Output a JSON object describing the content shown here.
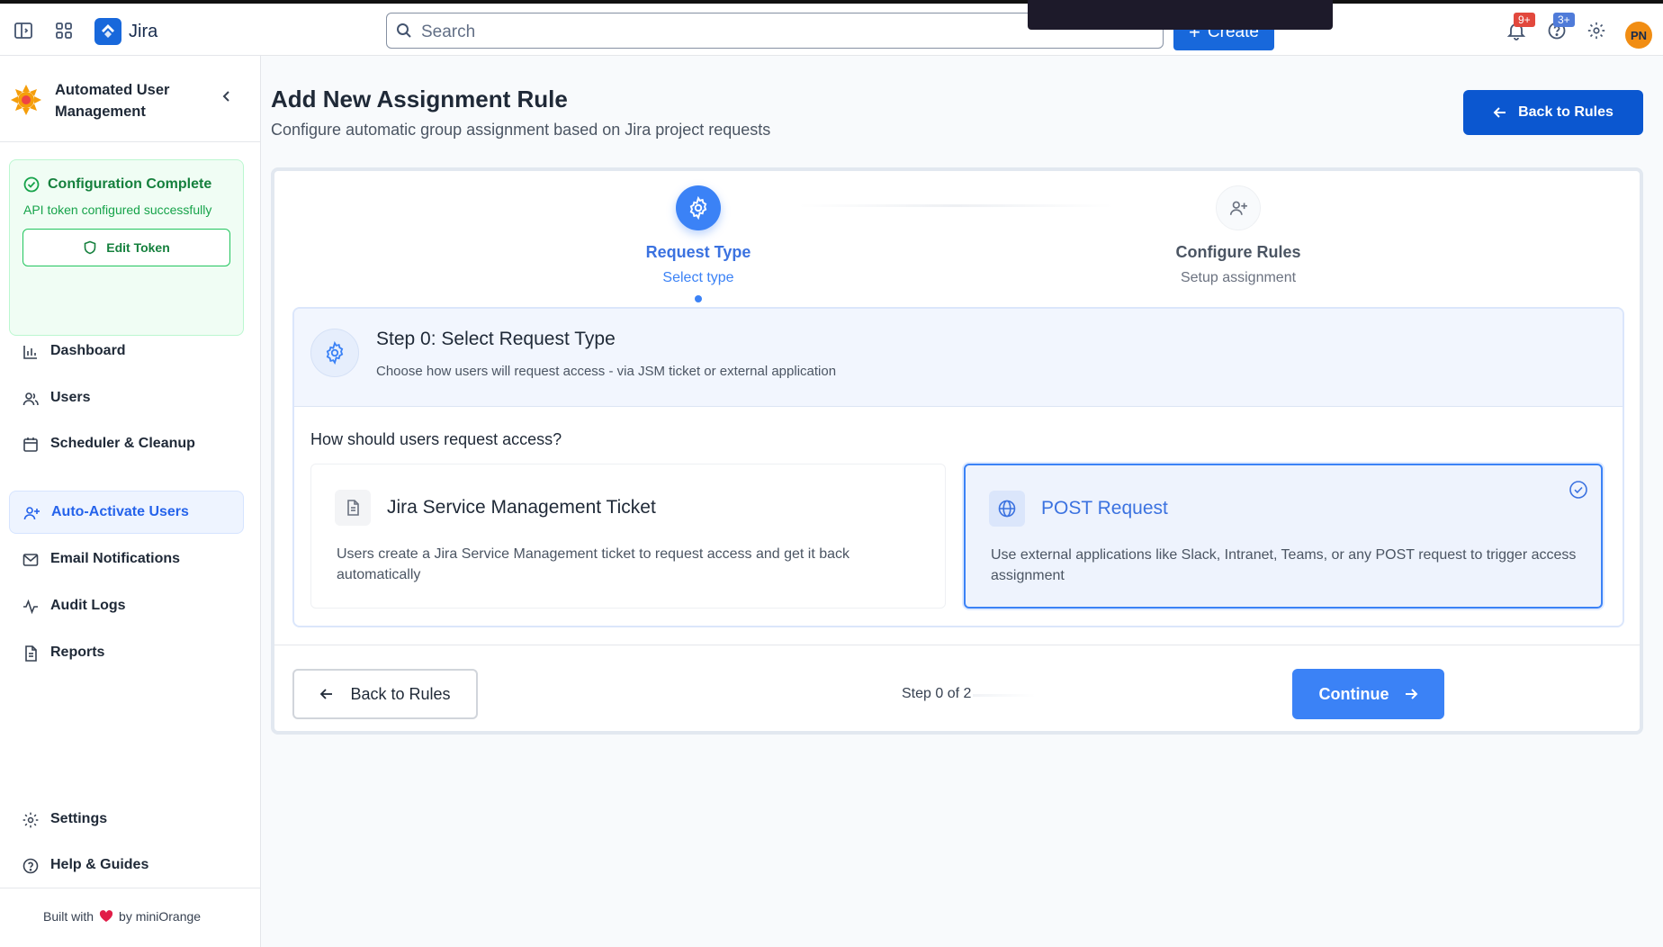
{
  "topbar": {
    "app_name": "Jira",
    "search_placeholder": "Search",
    "create_label": "Create",
    "notifications_badge": "9+",
    "help_badge": "3+",
    "avatar_initials": "PN"
  },
  "sidebar": {
    "app_title_line1": "Automated User",
    "app_title_line2": "Management",
    "config": {
      "title": "Configuration Complete",
      "subtitle": "API token configured successfully",
      "button": "Edit Token"
    },
    "items": [
      {
        "label": "Dashboard",
        "icon": "bar-chart-icon"
      },
      {
        "label": "Users",
        "icon": "users-icon"
      },
      {
        "label": "Scheduler & Cleanup",
        "icon": "calendar-icon"
      },
      {
        "label": "Auto-Activate Users",
        "icon": "user-plus-icon",
        "active": true
      },
      {
        "label": "Email Notifications",
        "icon": "mail-icon"
      },
      {
        "label": "Audit Logs",
        "icon": "activity-icon"
      },
      {
        "label": "Reports",
        "icon": "document-icon"
      }
    ],
    "bottom_items": [
      {
        "label": "Settings",
        "icon": "gear-icon"
      },
      {
        "label": "Help & Guides",
        "icon": "help-circle-icon"
      }
    ],
    "built_prefix": "Built with",
    "built_suffix": "by miniOrange"
  },
  "main": {
    "title": "Add New Assignment Rule",
    "subtitle": "Configure automatic group assignment based on Jira project requests",
    "back_to_rules": "Back to Rules",
    "steps": [
      {
        "title": "Request Type",
        "subtitle": "Select type",
        "active": true
      },
      {
        "title": "Configure Rules",
        "subtitle": "Setup assignment",
        "active": false
      }
    ],
    "section": {
      "title": "Step 0: Select Request Type",
      "description": "Choose how users will request access - via JSM ticket or external application",
      "question": "How should users request access?",
      "options": [
        {
          "title": "Jira Service Management Ticket",
          "description": "Users create a Jira Service Management ticket to request access and get it back automatically",
          "selected": false
        },
        {
          "title": "POST Request",
          "description": "Use external applications like Slack, Intranet, Teams, or any POST request to trigger access assignment",
          "selected": true
        }
      ]
    },
    "footer": {
      "back_label": "Back to Rules",
      "step_text": "Step 0 of 2",
      "continue_label": "Continue"
    }
  },
  "colors": {
    "primary": "#3b82f6",
    "jira_blue": "#1868db",
    "success": "#15803d"
  }
}
